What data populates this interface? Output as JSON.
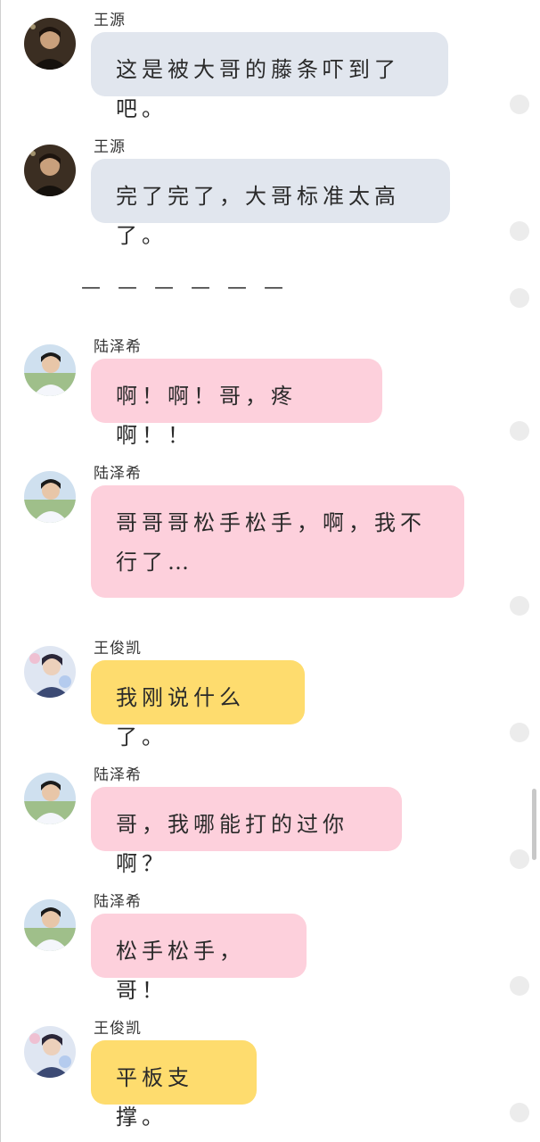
{
  "messages": [
    {
      "sender": "王源",
      "text": "这是被大哥的藤条吓到了吧。",
      "color": "#e1e6ee",
      "avatar": "wangyuan-avatar"
    },
    {
      "sender": "王源",
      "text": "完了完了，大哥标准太高了。",
      "color": "#e1e6ee",
      "avatar": "wangyuan-avatar"
    },
    {
      "sender": "陆泽希",
      "text": "啊！啊！哥，疼啊！！",
      "color": "#fdd0dc",
      "avatar": "luzexi-avatar"
    },
    {
      "sender": "陆泽希",
      "text": "哥哥哥松手松手，啊，我不行了…",
      "color": "#fdd0dc",
      "avatar": "luzexi-avatar"
    },
    {
      "sender": "王俊凯",
      "text": "我刚说什么了。",
      "color": "#fedc6e",
      "avatar": "wangjunkai-avatar"
    },
    {
      "sender": "陆泽希",
      "text": "哥，我哪能打的过你啊？",
      "color": "#fdd0dc",
      "avatar": "luzexi-avatar"
    },
    {
      "sender": "陆泽希",
      "text": "松手松手，哥！",
      "color": "#fdd0dc",
      "avatar": "luzexi-avatar"
    },
    {
      "sender": "王俊凯",
      "text": "平板支撑。",
      "color": "#fedc6e",
      "avatar": "wangjunkai-avatar"
    }
  ],
  "divider": "— — — — — —"
}
